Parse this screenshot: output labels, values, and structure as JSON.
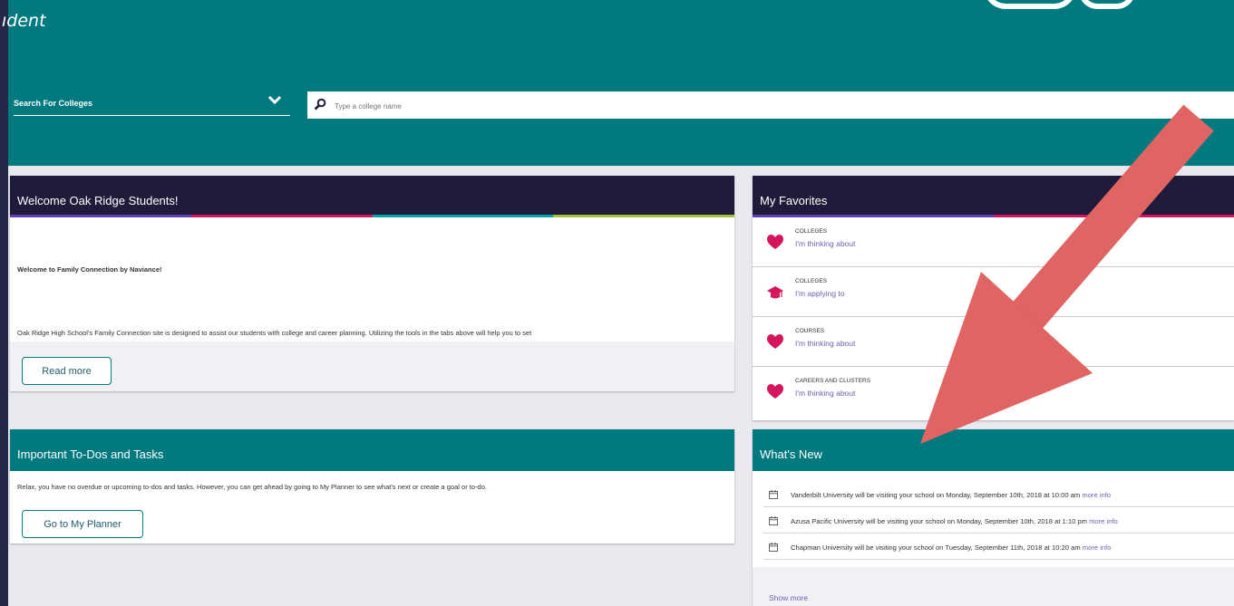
{
  "header": {
    "title_fragment": "ıdent",
    "search_type_label": "Search For Colleges",
    "search_placeholder": "Type a college name"
  },
  "welcome": {
    "title": "Welcome Oak Ridge Students!",
    "heading": "Welcome to Family Connection by Naviance!",
    "body": "Oak Ridge High School's Family Connection site is designed to assist our students with college and career planning. Utilizing the tools in the tabs above will help you to set",
    "button": "Read more"
  },
  "todos": {
    "title": "Important To-Dos and Tasks",
    "body": "Relax, you have no overdue or upcoming to-dos and tasks. However, you can get ahead by going to My Planner to see what's next or create a goal or to-do.",
    "button": "Go to My Planner"
  },
  "favorites": {
    "title": "My Favorites",
    "items": [
      {
        "category": "COLLEGES",
        "link": "I'm thinking about",
        "icon": "heart-icon"
      },
      {
        "category": "COLLEGES",
        "link": "I'm applying to",
        "icon": "graduation-cap-icon"
      },
      {
        "category": "COURSES",
        "link": "I'm thinking about",
        "icon": "heart-icon"
      },
      {
        "category": "CAREERS AND CLUSTERS",
        "link": "I'm thinking about",
        "icon": "heart-icon"
      }
    ]
  },
  "whats_new": {
    "title": "What's New",
    "items": [
      {
        "text": "Vanderbilt University will be visiting your school on Monday, September 10th, 2018 at 10:00 am",
        "more": "more info"
      },
      {
        "text": "Azusa Pacific University will be visiting your school on Monday, September 10th, 2018 at 1:10 pm",
        "more": "more info"
      },
      {
        "text": "Chapman University will be visiting your school on Tuesday, September 11th, 2018 at 10:20 am",
        "more": "more info"
      }
    ],
    "show_more": "Show more"
  },
  "colors": {
    "teal": "#00797f",
    "navy": "#1e1c3a",
    "page_bg": "#e9e9f0",
    "frame_bg": "#232846",
    "heart": "#d6155f",
    "link": "#6b63b5",
    "arrow": "#e06461",
    "stripe": [
      "#5b3fb3",
      "#d6155f",
      "#00a3a8",
      "#a3c23a"
    ]
  }
}
